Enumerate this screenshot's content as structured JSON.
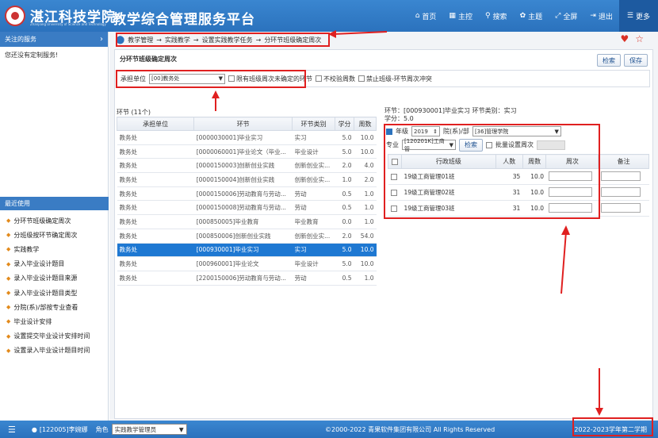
{
  "header": {
    "school_name": "湛江科技学院",
    "school_sub": "Zhanjiang University of Science and Technology",
    "platform_title": "教学综合管理服务平台",
    "nav": [
      {
        "label": "首页",
        "icon": "home-icon"
      },
      {
        "label": "主控",
        "icon": "windows-icon"
      },
      {
        "label": "搜索",
        "icon": "search-icon"
      },
      {
        "label": "主题",
        "icon": "theme-icon"
      },
      {
        "label": "全屏",
        "icon": "fullscreen-icon"
      },
      {
        "label": "退出",
        "icon": "logout-icon"
      },
      {
        "label": "更多",
        "icon": "menu-icon"
      }
    ]
  },
  "sidebar": {
    "favorites_title": "关注的服务",
    "favorites_empty": "您还没有定制服务!",
    "recent_title": "最近使用",
    "recent_items": [
      "分环节班级确定周次",
      "分班级按环节确定周次",
      "实践教学",
      "录入毕业设计题目",
      "录入毕业设计题目来源",
      "录入毕业设计题目类型",
      "分院(系)/部按专业查看",
      "毕业设计安排",
      "设置提交毕业设计安排时间",
      "设置录入毕业设计题目时间"
    ]
  },
  "breadcrumb": [
    "教学管理",
    "实践教学",
    "设置实践教学任务",
    "分环节班级确定周次"
  ],
  "panel": {
    "title": "分环节班级确定周次",
    "search_btn": "检索",
    "save_btn": "保存",
    "filter": {
      "unit_label": "承担单位",
      "unit_value": "[00]教务处",
      "opt1": "限有班级周次未确定的环节",
      "opt2": "不校验周数",
      "opt3": "禁止班级-环节周次冲突"
    }
  },
  "left_table": {
    "caption": "环节 (11个)",
    "headers": [
      "承担单位",
      "环节",
      "环节类别",
      "学分",
      "周数"
    ],
    "rows": [
      [
        "教务处",
        "[0000030001]毕业实习",
        "实习",
        "5.0",
        "10.0"
      ],
      [
        "教务处",
        "[0000060001]毕业论文（毕业...",
        "毕业设计",
        "5.0",
        "10.0"
      ],
      [
        "教务处",
        "[0000150003]创新创业实践",
        "创新创业实...",
        "2.0",
        "4.0"
      ],
      [
        "教务处",
        "[0000150004]创新创业实践",
        "创新创业实...",
        "1.0",
        "2.0"
      ],
      [
        "教务处",
        "[0000150006]劳动教育与劳动...",
        "劳动",
        "0.5",
        "1.0"
      ],
      [
        "教务处",
        "[0000150008]劳动教育与劳动...",
        "劳动",
        "0.5",
        "1.0"
      ],
      [
        "教务处",
        "[000850005]毕业教育",
        "毕业教育",
        "0.0",
        "1.0"
      ],
      [
        "教务处",
        "[000850006]创新创业实践",
        "创新创业实...",
        "2.0",
        "54.0"
      ],
      [
        "教务处",
        "[000930001]毕业实习",
        "实习",
        "5.0",
        "10.0"
      ],
      [
        "教务处",
        "[000960001]毕业论文",
        "毕业设计",
        "5.0",
        "10.0"
      ],
      [
        "教务处",
        "[2200150006]劳动教育与劳动...",
        "劳动",
        "0.5",
        "1.0"
      ]
    ],
    "selected_index": 8
  },
  "right": {
    "info_line1": "环节：[000930001]毕业实习   环节类别：实习",
    "info_line2": "学分：5.0",
    "grade_label": "年级",
    "grade_value": "2019",
    "dept_label": "院(系)/部",
    "dept_value": "[36]管理学院",
    "major_label": "专业",
    "major_value": "[120201K]工商管",
    "search_btn": "检索",
    "batch_label": "批量设置周次",
    "headers": [
      "行政班级",
      "人数",
      "周数",
      "周次",
      "备注"
    ],
    "rows": [
      [
        "19级工商管理01班",
        "35",
        "10.0"
      ],
      [
        "19级工商管理02班",
        "31",
        "10.0"
      ],
      [
        "19级工商管理03班",
        "31",
        "10.0"
      ]
    ]
  },
  "footer": {
    "user": "[122005]李婉娜",
    "role_label": "角色",
    "role_value": "实践教学管理员",
    "copyright": "©2000-2022 青果软件集团有限公司 All Rights Reserved",
    "term": "2022-2023学年第二学期"
  }
}
